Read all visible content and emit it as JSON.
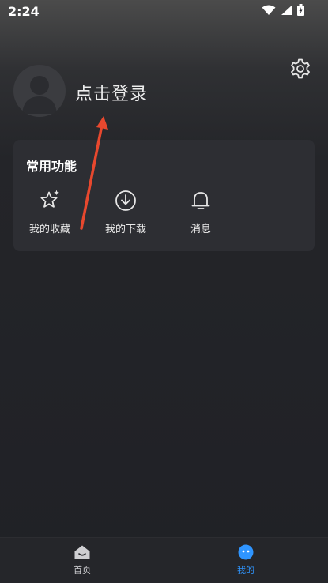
{
  "status_bar": {
    "time": "2:24",
    "icons": [
      "wifi-icon",
      "cellular-signal-icon",
      "battery-charging-icon"
    ]
  },
  "header": {
    "settings_icon": "gear-icon",
    "avatar_icon": "user-avatar-icon",
    "login_text": "点击登录"
  },
  "functions": {
    "title": "常用功能",
    "items": [
      {
        "label": "我的收藏",
        "icon": "star-sparkle-icon"
      },
      {
        "label": "我的下载",
        "icon": "download-circle-icon"
      },
      {
        "label": "消息",
        "icon": "bell-icon"
      }
    ]
  },
  "bottom_nav": {
    "items": [
      {
        "label": "首页",
        "icon": "home-face-icon",
        "active": false
      },
      {
        "label": "我的",
        "icon": "profile-face-icon",
        "active": true
      }
    ],
    "active_color": "#2f95ff",
    "inactive_color": "#cfcfd2"
  },
  "annotation": {
    "arrow_color": "#e8482e"
  }
}
